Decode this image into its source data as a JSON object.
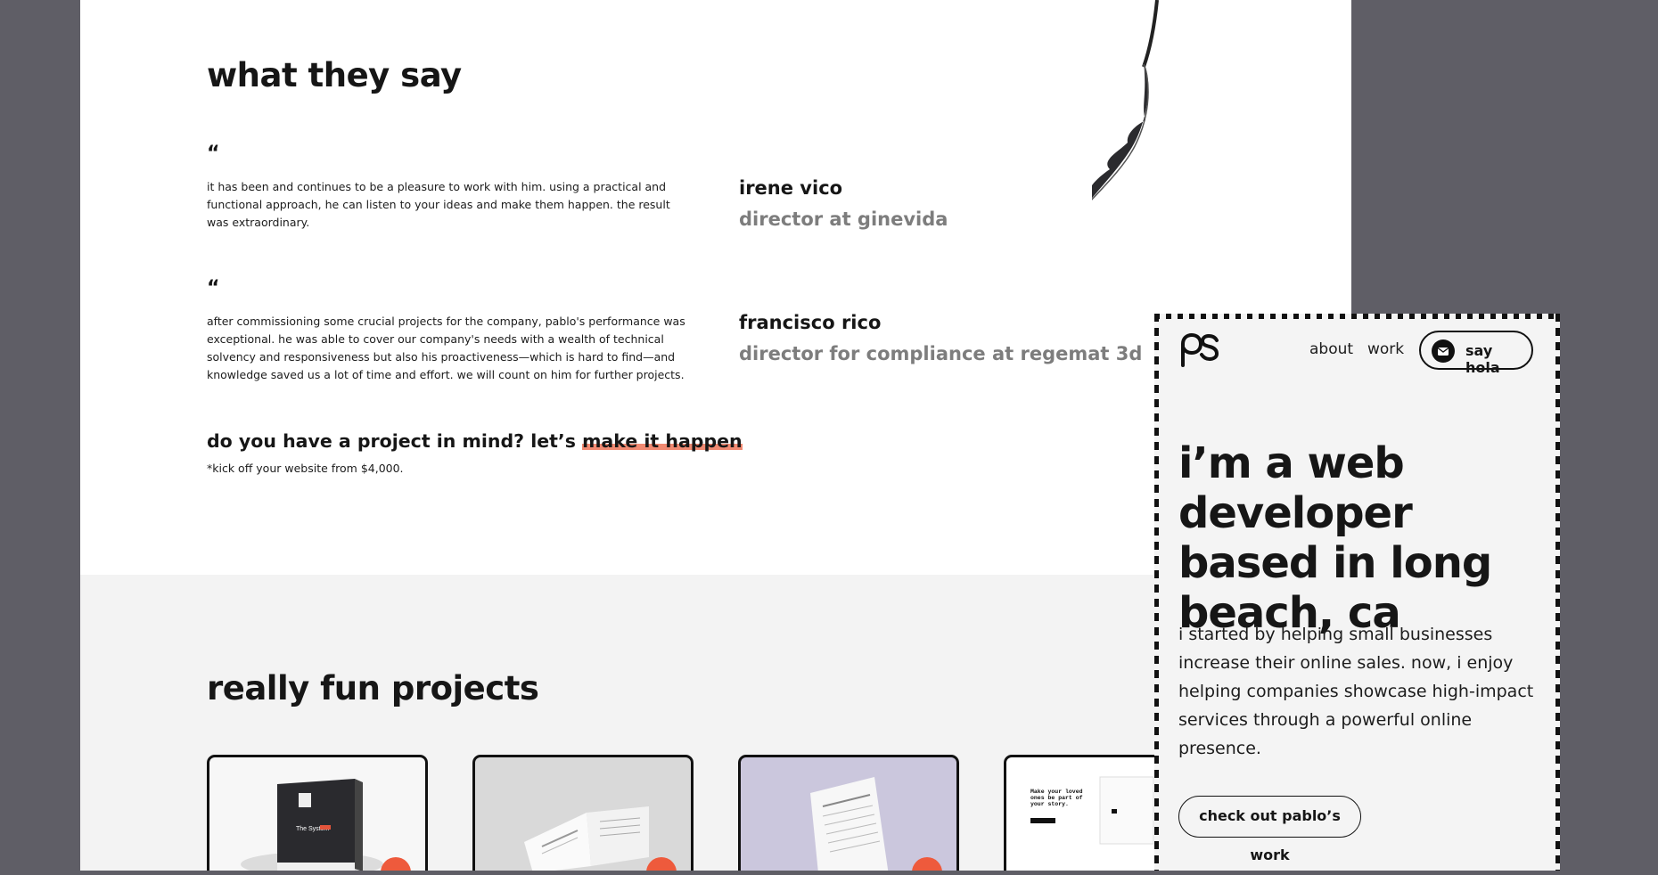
{
  "testimonials": {
    "heading": "what they say",
    "items": [
      {
        "quote_mark": "“",
        "text": "it has been and continues to be a pleasure to work with him. using a practical and functional approach, he can listen to your ideas and make them happen. the result was extraordinary.",
        "name": "irene vico",
        "role": "director at ginevida"
      },
      {
        "quote_mark": "“",
        "text": "after commissioning some crucial projects for the company, pablo's performance was exceptional. he was able to cover our company's needs with a wealth of technical solvency and responsiveness but also his proactiveness—which is hard to find—and knowledge saved us a lot of time and effort. we will count on him for further projects.",
        "name": "francisco rico",
        "role": "director for compliance at regemat 3d"
      }
    ],
    "cta_prefix": "do you have a project in mind? let’s ",
    "cta_link": "make it happen",
    "cta_note": "*kick off your website from $4,000."
  },
  "projects": {
    "heading": "really fun projects",
    "cards": [
      {
        "name": "the-system-notion-template",
        "box_text": "The System"
      },
      {
        "name": "open-booklet-mockup",
        "box_text": ""
      },
      {
        "name": "resume-paper-mockup",
        "box_text": ""
      },
      {
        "name": "website-mockup",
        "box_text": "Make your loved ones be part of your story."
      }
    ]
  },
  "panel": {
    "logo": "ps",
    "nav": [
      "about",
      "work"
    ],
    "cta": "say hola",
    "hero_title": "i’m a web developer based in long beach, ca",
    "hero_text": "i started by helping small businesses increase their online sales. now, i enjoy helping companies showcase high-impact services through a powerful online presence.",
    "work_button": "check out pablo’s work"
  },
  "colors": {
    "backdrop": "#5f5e66",
    "highlight": "#f08a72",
    "badge": "#ee5a3c",
    "muted_text": "#7d7d7d"
  }
}
